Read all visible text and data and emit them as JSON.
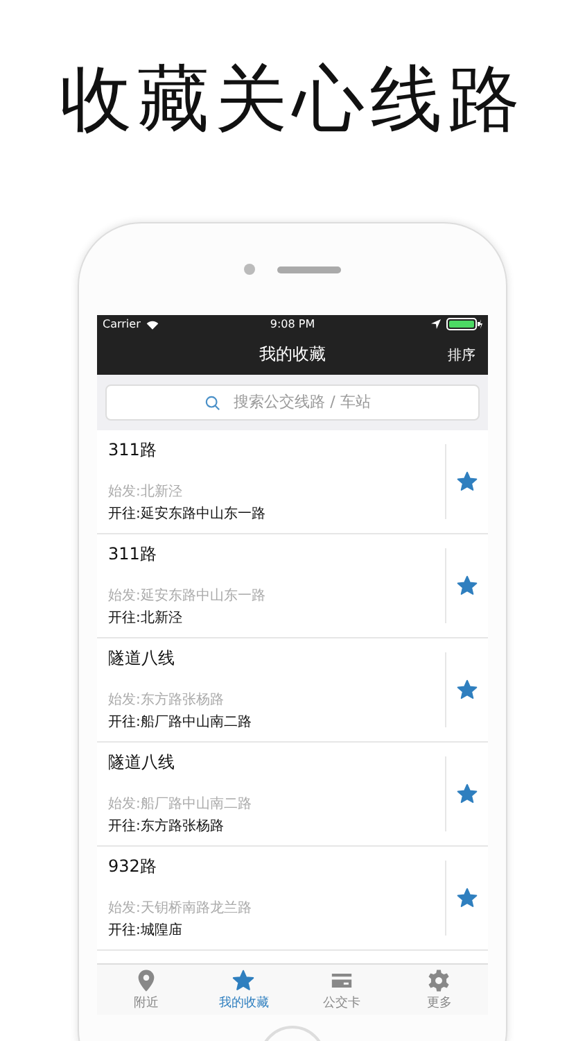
{
  "headline": "收藏关心线路",
  "status_bar": {
    "carrier": "Carrier",
    "time": "9:08 PM"
  },
  "nav": {
    "title": "我的收藏",
    "action": "排序"
  },
  "search": {
    "placeholder": "搜索公交线路 / 车站"
  },
  "routes": [
    {
      "name": "311路",
      "from": "始发:北新泾",
      "to": "开往:延安东路中山东一路"
    },
    {
      "name": "311路",
      "from": "始发:延安东路中山东一路",
      "to": "开往:北新泾"
    },
    {
      "name": "隧道八线",
      "from": "始发:东方路张杨路",
      "to": "开往:船厂路中山南二路"
    },
    {
      "name": "隧道八线",
      "from": "始发:船厂路中山南二路",
      "to": "开往:东方路张杨路"
    },
    {
      "name": "932路",
      "from": "始发:天钥桥南路龙兰路",
      "to": "开往:城隍庙"
    }
  ],
  "tabs": [
    {
      "kind": "pin",
      "label": "附近",
      "selected": false
    },
    {
      "kind": "star",
      "label": "我的收藏",
      "selected": true
    },
    {
      "kind": "card",
      "label": "公交卡",
      "selected": false
    },
    {
      "kind": "gear",
      "label": "更多",
      "selected": false
    }
  ]
}
